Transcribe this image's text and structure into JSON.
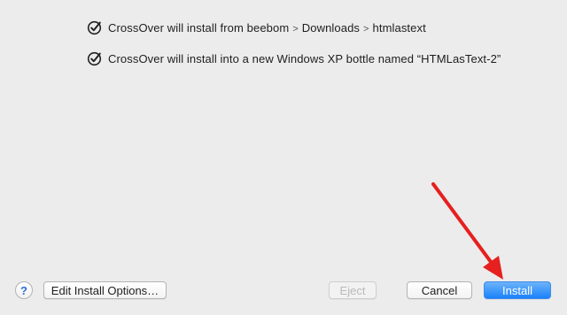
{
  "checklist": [
    {
      "icon": "checkmark-circle-icon",
      "prefix": "CrossOver will install from",
      "path": [
        "beebom",
        "Downloads",
        "htmlastext"
      ]
    },
    {
      "icon": "checkmark-circle-icon",
      "text": "CrossOver will install into a new Windows XP bottle named “HTMLasText-2”"
    }
  ],
  "footer": {
    "help_label": "?",
    "edit_label": "Edit Install Options…",
    "eject_label": "Eject",
    "cancel_label": "Cancel",
    "install_label": "Install"
  },
  "colors": {
    "background": "#ececec",
    "primary_button": "#1a82fb",
    "annotation_arrow": "#e5201f"
  }
}
